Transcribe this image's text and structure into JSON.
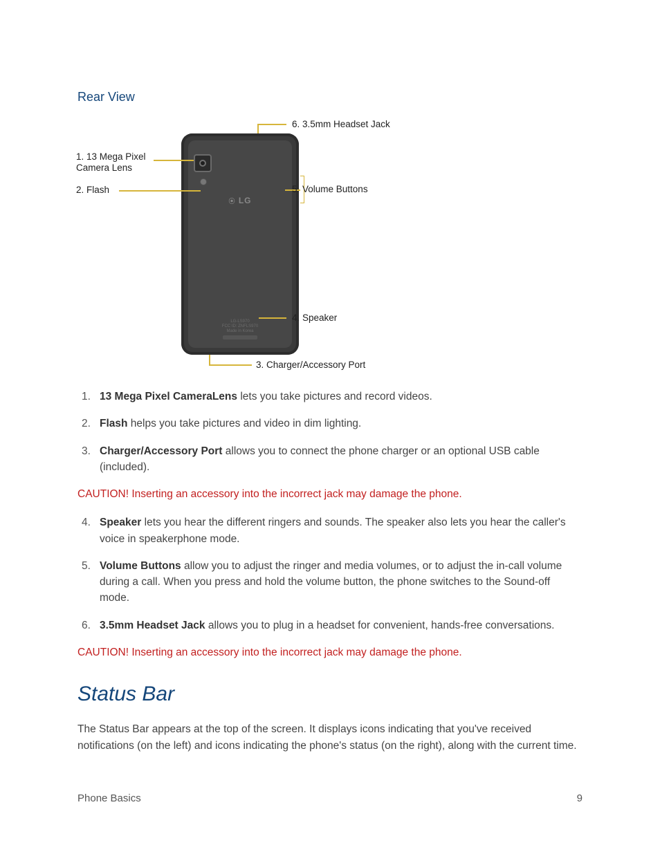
{
  "heading_rear_view": "Rear View",
  "diagram": {
    "label1": "1. 13 Mega Pixel\nCamera Lens",
    "label2": "2. Flash",
    "label3": "3. Charger/Accessory Port",
    "label4": "4. Speaker",
    "label5": "5. Volume Buttons",
    "label6": "6. 3.5mm Headset Jack",
    "logo": "LG",
    "cert": "LG-LS970\nFCC ID: ZNFLS970\nMade in Korea"
  },
  "list_a": [
    {
      "term": "13 Mega Pixel CameraLens",
      "desc": " lets you take pictures and record videos."
    },
    {
      "term": "Flash",
      "desc": " helps you take pictures and video in dim lighting."
    },
    {
      "term": "Charger/Accessory Port",
      "desc": " allows you to connect the phone charger or an optional USB cable (included)."
    }
  ],
  "caution1": "CAUTION! Inserting an accessory into the incorrect jack may damage the phone.",
  "list_b": [
    {
      "term": "Speaker",
      "desc": " lets you hear the different ringers and sounds. The speaker also lets you hear the caller's voice in speakerphone mode."
    },
    {
      "term": "Volume Buttons",
      "desc": " allow you to adjust the ringer and media volumes, or to adjust the in-call volume during a call. When you press and hold the volume button, the phone switches to the Sound-off mode."
    },
    {
      "term": "3.5mm Headset Jack",
      "desc": " allows you to plug in a headset for convenient, hands-free conversations."
    }
  ],
  "caution2": "CAUTION! Inserting an accessory into the incorrect jack may damage the phone.",
  "status_bar_heading": "Status Bar",
  "status_bar_body": "The Status Bar appears at the top of the screen. It displays icons indicating that you've received notifications (on the left) and icons indicating the phone's status (on the right), along with the current time.",
  "footer_left": "Phone Basics",
  "footer_right": "9"
}
